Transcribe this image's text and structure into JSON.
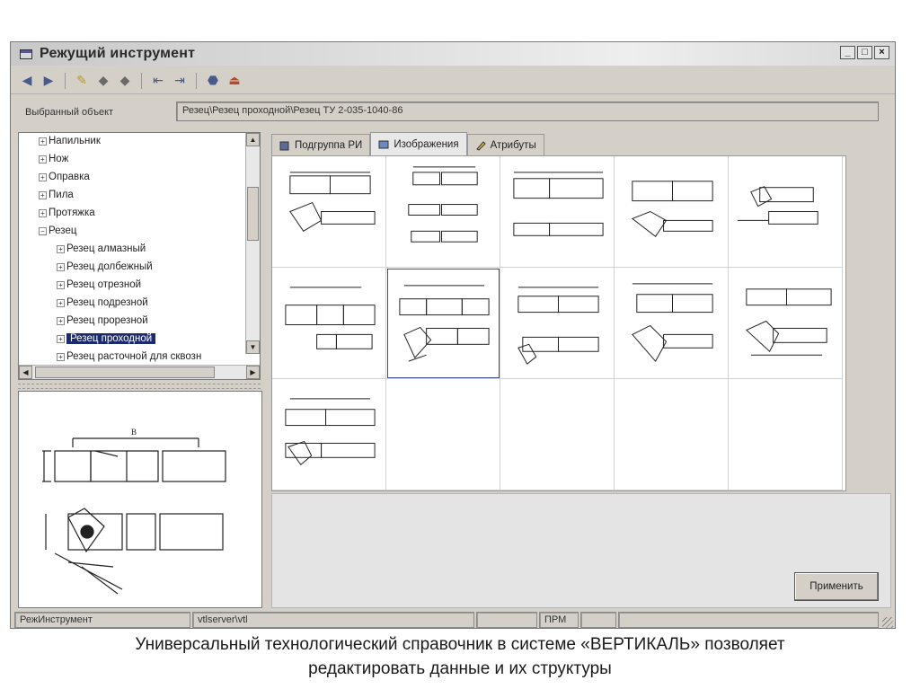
{
  "window": {
    "title": "Режущий инструмент",
    "btn_minimize": "_",
    "btn_maximize": "□",
    "btn_close": "×"
  },
  "toolbar": {
    "icons": [
      "arrow-left-icon",
      "arrow-right-icon",
      "edit-icon",
      "copy-icon",
      "paste-icon",
      "import-icon",
      "export-icon",
      "filter-icon",
      "exit-icon"
    ]
  },
  "selected_object": {
    "label": "Выбранный объект",
    "value": "Резец\\Резец проходной\\Резец ТУ 2-035-1040-86"
  },
  "tree": {
    "items": [
      {
        "label": "Напильник",
        "expander": "+",
        "level": 0
      },
      {
        "label": "Нож",
        "expander": "+",
        "level": 0
      },
      {
        "label": "Оправка",
        "expander": "+",
        "level": 0
      },
      {
        "label": "Пила",
        "expander": "+",
        "level": 0
      },
      {
        "label": "Протяжка",
        "expander": "+",
        "level": 0
      },
      {
        "label": "Резец",
        "expander": "−",
        "level": 0
      },
      {
        "label": "Резец алмазный",
        "expander": "+",
        "level": 1
      },
      {
        "label": "Резец долбежный",
        "expander": "+",
        "level": 1
      },
      {
        "label": "Резец отрезной",
        "expander": "+",
        "level": 1
      },
      {
        "label": "Резец подрезной",
        "expander": "+",
        "level": 1
      },
      {
        "label": "Резец прорезной",
        "expander": "+",
        "level": 1
      },
      {
        "label": "Резец проходной",
        "expander": "+",
        "level": 1,
        "selected": true
      },
      {
        "label": "Резец расточной для сквозн",
        "expander": "+",
        "level": 1
      }
    ]
  },
  "tabs": [
    {
      "label": "Подгруппа РИ",
      "icon": "folder-icon"
    },
    {
      "label": "Изображения",
      "icon": "image-icon",
      "active": true
    },
    {
      "label": "Атрибуты",
      "icon": "pencil-icon"
    }
  ],
  "apply_button": "Применить",
  "status": {
    "panel1": "РежИнструмент",
    "panel2": "vtlserver\\vtl",
    "panel3": "",
    "panel4": "ПРМ",
    "panel5": "",
    "panel6": ""
  },
  "caption": {
    "line1": "Универсальный технологический справочник в системе «ВЕРТИКАЛЬ» позволяет",
    "line2": "редактировать данные и их структуры"
  },
  "colors": {
    "window_bg": "#d4d0c8",
    "selection": "#1c2a6e"
  }
}
